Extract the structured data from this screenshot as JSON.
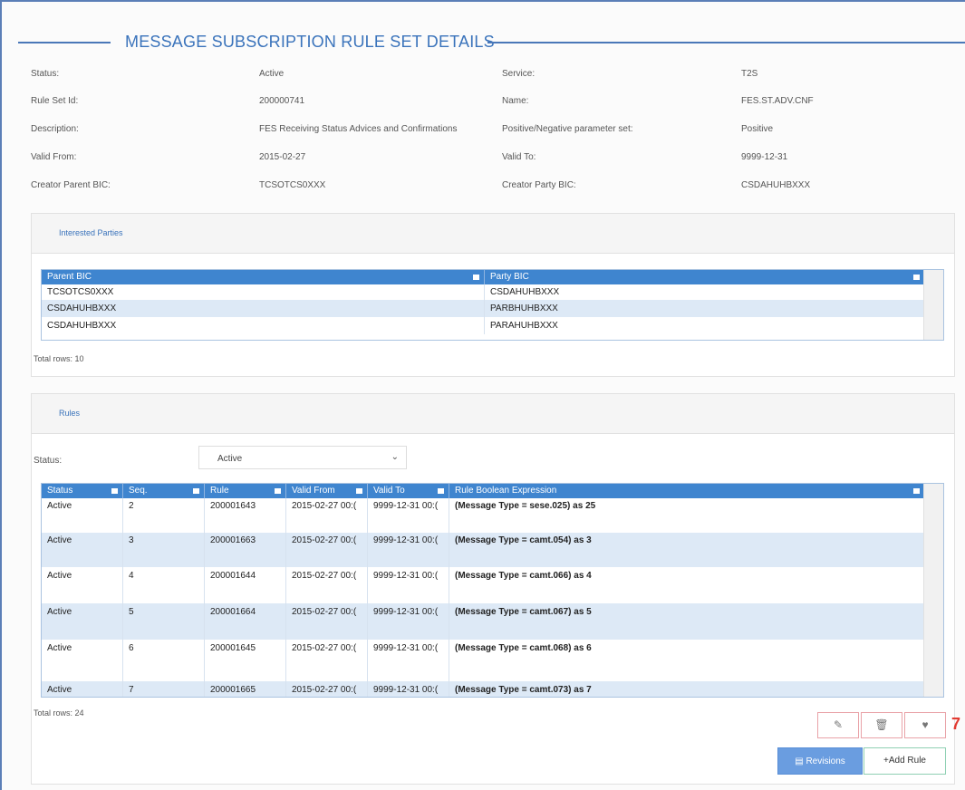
{
  "page": {
    "title": "MESSAGE SUBSCRIPTION RULE SET DETAILS",
    "accent": "#3a73bb",
    "header_bg": "#3f85cf"
  },
  "details": [
    {
      "label1": "Status:",
      "value1": "Active",
      "label2": "Service:",
      "value2": "T2S"
    },
    {
      "label1": "Rule Set Id:",
      "value1": "200000741",
      "label2": "Name:",
      "value2": "FES.ST.ADV.CNF"
    },
    {
      "label1": "Description:",
      "value1": "FES Receiving Status Advices and Confirmations",
      "label2": "Positive/Negative parameter set:",
      "value2": "Positive"
    },
    {
      "label1": "Valid From:",
      "value1": "2015-02-27",
      "label2": "Valid To:",
      "value2": "9999-12-31"
    },
    {
      "label1": "Creator Parent BIC:",
      "value1": "TCSOTCS0XXX",
      "label2": "Creator Party BIC:",
      "value2": "CSDAHUHBXXX"
    }
  ],
  "interested_parties": {
    "tab_label": "Interested Parties",
    "columns": [
      "Parent BIC",
      "Party BIC"
    ],
    "rows": [
      [
        "TCSOTCS0XXX",
        "CSDAHUHBXXX"
      ],
      [
        "CSDAHUHBXXX",
        "PARBHUHBXXX"
      ],
      [
        "CSDAHUHBXXX",
        "PARAHUHBXXX"
      ]
    ],
    "total_rows": "Total rows: 10"
  },
  "rules": {
    "tab_label": "Rules",
    "status_label": "Status:",
    "status_value": "Active",
    "columns": [
      "Status",
      "Seq.",
      "Rule",
      "Valid From",
      "Valid To",
      "Rule Boolean Expression"
    ],
    "rows": [
      [
        "Active",
        "2",
        "200001643",
        "2015-02-27 00:(",
        "9999-12-31 00:(",
        "(Message Type = sese.025) as 25"
      ],
      [
        "Active",
        "3",
        "200001663",
        "2015-02-27 00:(",
        "9999-12-31 00:(",
        "(Message Type = camt.054) as 3"
      ],
      [
        "Active",
        "4",
        "200001644",
        "2015-02-27 00:(",
        "9999-12-31 00:(",
        "(Message Type = camt.066) as 4"
      ],
      [
        "Active",
        "5",
        "200001664",
        "2015-02-27 00:(",
        "9999-12-31 00:(",
        "(Message Type = camt.067) as 5"
      ],
      [
        "Active",
        "6",
        "200001645",
        "2015-02-27 00:(",
        "9999-12-31 00:(",
        "(Message Type = camt.068) as 6"
      ],
      [
        "Active",
        "7",
        "200001665",
        "2015-02-27 00:(",
        "9999-12-31 00:(",
        "(Message Type = camt.073) as 7"
      ]
    ],
    "total_rows": "Total rows: 24"
  },
  "actions": {
    "edit_icon": "pencil-icon",
    "delete_icon": "trash-icon",
    "restore_icon": "heart-icon",
    "callout": "7",
    "revisions_label": "Revisions",
    "add_rule_label": "+Add Rule"
  }
}
